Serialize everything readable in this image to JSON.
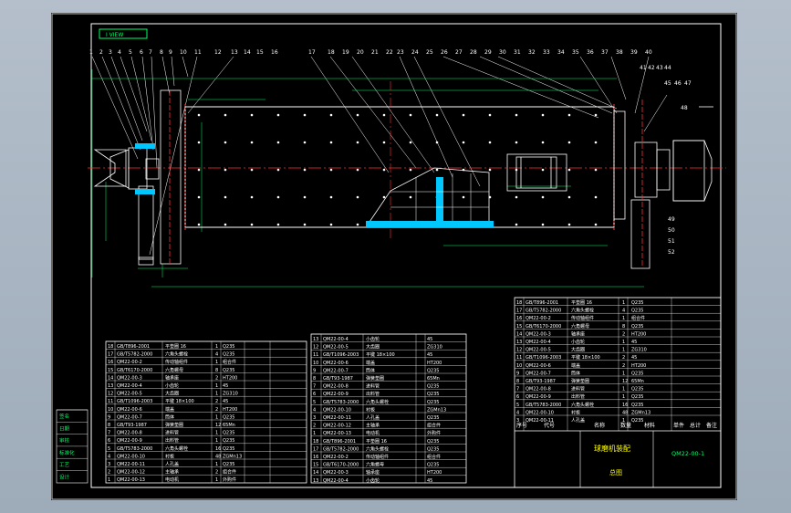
{
  "drawing": {
    "view_tag": "I VIEW",
    "top_numbers": [
      "1",
      "2",
      "3",
      "4",
      "5",
      "6",
      "7",
      "8",
      "9",
      "10",
      "11",
      "12",
      "13",
      "14",
      "15",
      "16",
      "17",
      "18",
      "19",
      "20",
      "21",
      "22",
      "23",
      "24",
      "25",
      "26",
      "27",
      "28",
      "29",
      "30",
      "31",
      "32",
      "33",
      "34",
      "35",
      "36",
      "37",
      "38",
      "39",
      "40",
      "41",
      "42",
      "43",
      "44",
      "45",
      "46",
      "47"
    ],
    "right_numbers": [
      "48",
      "49",
      "50",
      "51",
      "52"
    ],
    "title_main": "球磨机装配",
    "title_sub": "总图",
    "drawing_no": "QM22-00-1",
    "title_header": [
      "序号",
      "代号",
      "名称",
      "数量",
      "材料",
      "单件",
      "总计",
      "备注"
    ],
    "left_stamps": [
      "签名",
      "日期",
      "审核",
      "标准化",
      "工艺",
      "设计"
    ]
  },
  "bom_rows": [
    [
      "18",
      "GB/T896-2001",
      "平垫圈 16",
      "1",
      "Q235"
    ],
    [
      "17",
      "GB/T5782-2000",
      "六角头螺栓",
      "4",
      "Q235"
    ],
    [
      "16",
      "QM22-00-2",
      "传动轴组件",
      "1",
      "组合件"
    ],
    [
      "15",
      "GB/T6170-2000",
      "六角螺母",
      "8",
      "Q235"
    ],
    [
      "14",
      "QM22-00-3",
      "轴承座",
      "2",
      "HT200"
    ],
    [
      "13",
      "QM22-00-4",
      "小齿轮",
      "1",
      "45"
    ],
    [
      "12",
      "QM22-00-5",
      "大齿圈",
      "1",
      "ZG310"
    ],
    [
      "11",
      "GB/T1096-2003",
      "平键 18×100",
      "2",
      "45"
    ],
    [
      "10",
      "QM22-00-6",
      "端盖",
      "2",
      "HT200"
    ],
    [
      "9",
      "QM22-00-7",
      "筒体",
      "1",
      "Q235"
    ],
    [
      "8",
      "GB/T93-1987",
      "弹簧垫圈",
      "12",
      "65Mn"
    ],
    [
      "7",
      "QM22-00-8",
      "进料管",
      "1",
      "Q235"
    ],
    [
      "6",
      "QM22-00-9",
      "出料管",
      "1",
      "Q235"
    ],
    [
      "5",
      "GB/T5783-2000",
      "六角头螺栓",
      "16",
      "Q235"
    ],
    [
      "4",
      "QM22-00-10",
      "衬板",
      "48",
      "ZGMn13"
    ],
    [
      "3",
      "QM22-00-11",
      "人孔盖",
      "1",
      "Q235"
    ],
    [
      "2",
      "QM22-00-12",
      "主轴承",
      "2",
      "组合件"
    ],
    [
      "1",
      "QM22-00-13",
      "电动机",
      "1",
      "外购件"
    ]
  ]
}
